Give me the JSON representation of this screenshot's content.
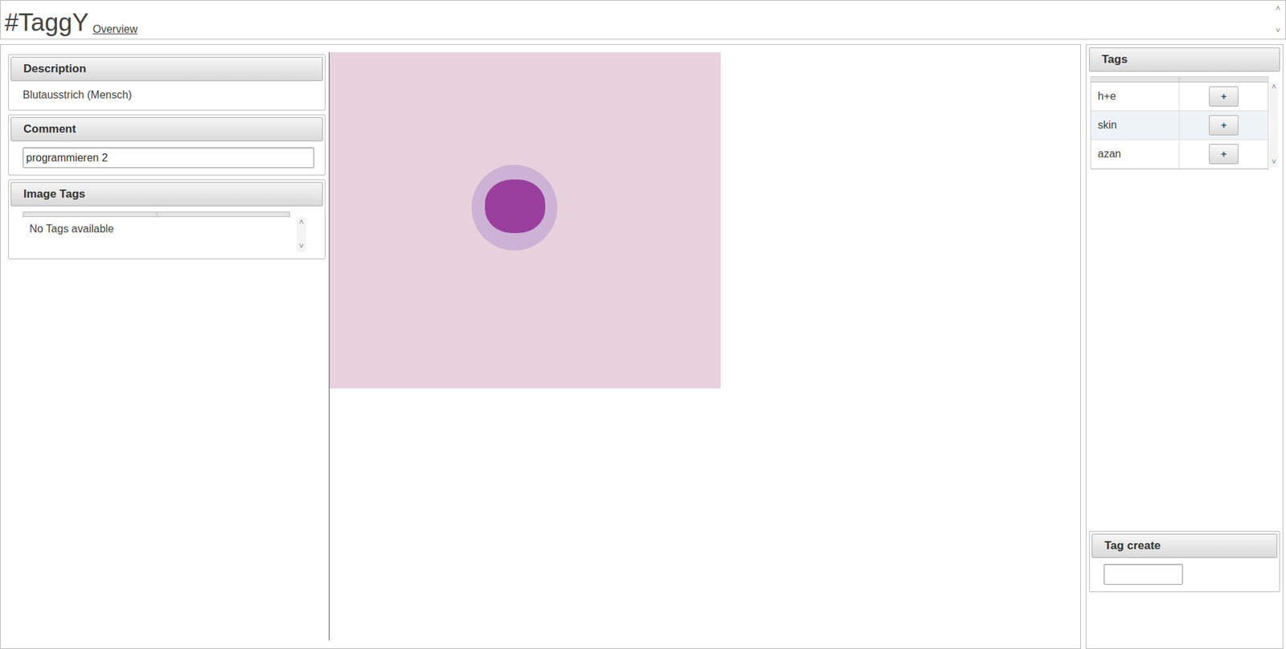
{
  "header": {
    "logo": "#TaggY",
    "nav_link": "Overview",
    "scroll_icons": [
      "˄",
      "˅"
    ]
  },
  "description": {
    "title": "Description",
    "text": "Blutausstrich (Mensch)"
  },
  "comment": {
    "title": "Comment",
    "value": "programmieren 2"
  },
  "image_tags": {
    "title": "Image Tags",
    "empty_text": "No Tags available",
    "scroll_icons": [
      "˄",
      "˅"
    ]
  },
  "tags": {
    "title": "Tags",
    "scroll_icons": [
      "˄",
      "˅"
    ],
    "rows": [
      {
        "name": "h+e",
        "button": "+"
      },
      {
        "name": "skin",
        "button": "+"
      },
      {
        "name": "azan",
        "button": "+"
      }
    ]
  },
  "tag_create": {
    "title": "Tag create",
    "value": ""
  }
}
